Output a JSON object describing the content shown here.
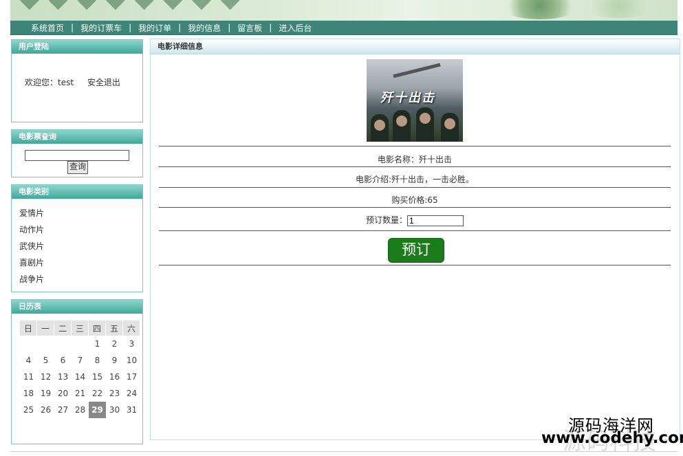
{
  "nav": {
    "items": [
      "系统首页",
      "我的订票车",
      "我的订单",
      "我的信息",
      "留言板",
      "进入后台"
    ],
    "separator": "|"
  },
  "login": {
    "title": "用户登陆",
    "welcome": "欢迎您：test",
    "logout": "安全退出"
  },
  "search": {
    "title": "电影票查询",
    "value": "",
    "button": "查询"
  },
  "categories": {
    "title": "电影类别",
    "items": [
      "爱情片",
      "动作片",
      "武侠片",
      "喜剧片",
      "战争片"
    ]
  },
  "calendar": {
    "title": "日历表",
    "weekdays": [
      "日",
      "一",
      "二",
      "三",
      "四",
      "五",
      "六"
    ],
    "weeks": [
      [
        "",
        "",
        "",
        "",
        "1",
        "2",
        "3"
      ],
      [
        "4",
        "5",
        "6",
        "7",
        "8",
        "9",
        "10"
      ],
      [
        "11",
        "12",
        "13",
        "14",
        "15",
        "16",
        "17"
      ],
      [
        "18",
        "19",
        "20",
        "21",
        "22",
        "23",
        "24"
      ],
      [
        "25",
        "26",
        "27",
        "28",
        "29",
        "30",
        "31"
      ]
    ],
    "today": "29"
  },
  "detail": {
    "title": "电影详细信息",
    "poster_title": "歼十出击",
    "name": "电影名称：歼十出击",
    "intro": "电影介绍:歼十出击，一击必胜。",
    "price": "购买价格:65",
    "qty_label": "预订数量：",
    "qty_value": "1",
    "book_button": "预订"
  },
  "watermark": {
    "cn": "源码海洋网",
    "url": "www.codehy.com",
    "faint": "源码科技"
  },
  "colors": {
    "nav_bg": "#3f8478",
    "panel_header": "#3ea89b",
    "book_button": "#1a7d1a"
  }
}
